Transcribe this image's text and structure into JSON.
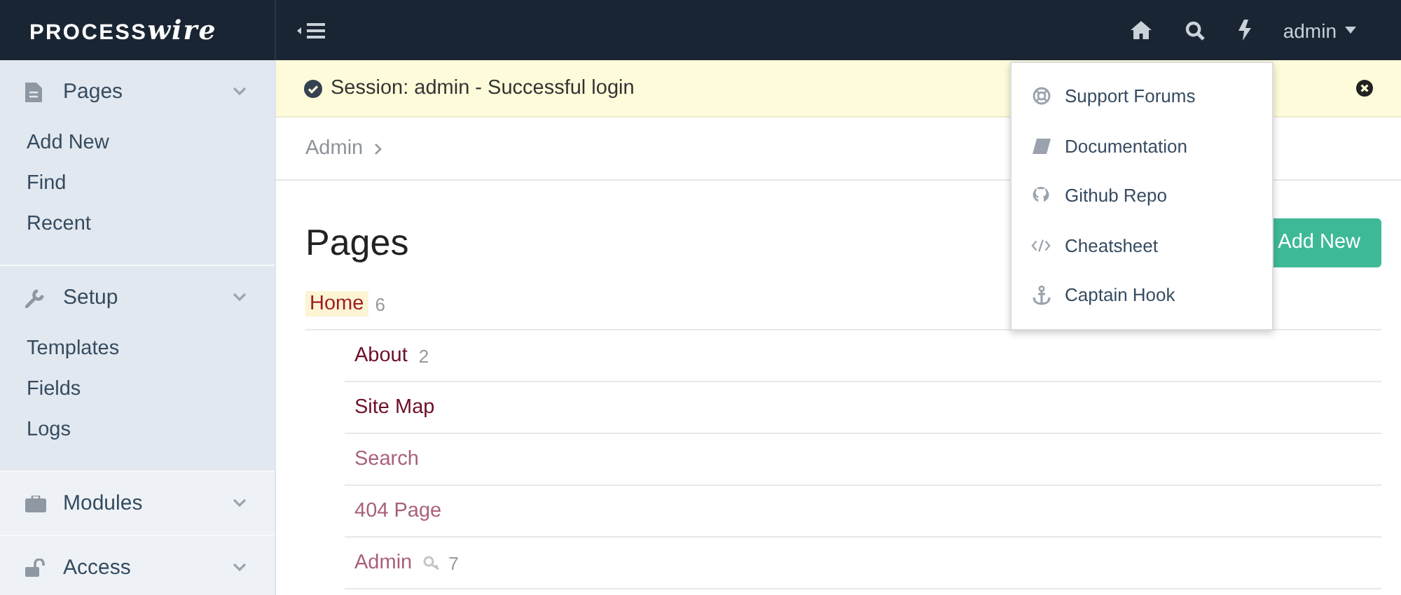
{
  "logo": {
    "text": "PROCESS",
    "script": "wire"
  },
  "topbar": {
    "user": "admin",
    "tools_open": true
  },
  "sidebar": {
    "sections": [
      {
        "label": "Pages",
        "expanded": true,
        "items": [
          "Add New",
          "Find",
          "Recent"
        ]
      },
      {
        "label": "Setup",
        "expanded": true,
        "items": [
          "Templates",
          "Fields",
          "Logs"
        ]
      },
      {
        "label": "Modules",
        "expanded": false
      },
      {
        "label": "Access",
        "expanded": false
      }
    ]
  },
  "notice": {
    "text": "Session: admin - Successful login"
  },
  "breadcrumb": [
    "Admin"
  ],
  "heading": "Pages",
  "add_button": "Add New",
  "tree": {
    "label": "Home",
    "count": "6",
    "selected": true,
    "children": [
      {
        "label": "About",
        "count": "2",
        "hidden": false,
        "locked": false
      },
      {
        "label": "Site Map",
        "hidden": false,
        "locked": false
      },
      {
        "label": "Search",
        "hidden": true,
        "locked": false
      },
      {
        "label": "404 Page",
        "hidden": true,
        "locked": false
      },
      {
        "label": "Admin",
        "count": "7",
        "hidden": true,
        "locked": true
      }
    ]
  },
  "tools_menu": [
    "Support Forums",
    "Documentation",
    "Github Repo",
    "Cheatsheet",
    "Captain Hook"
  ]
}
